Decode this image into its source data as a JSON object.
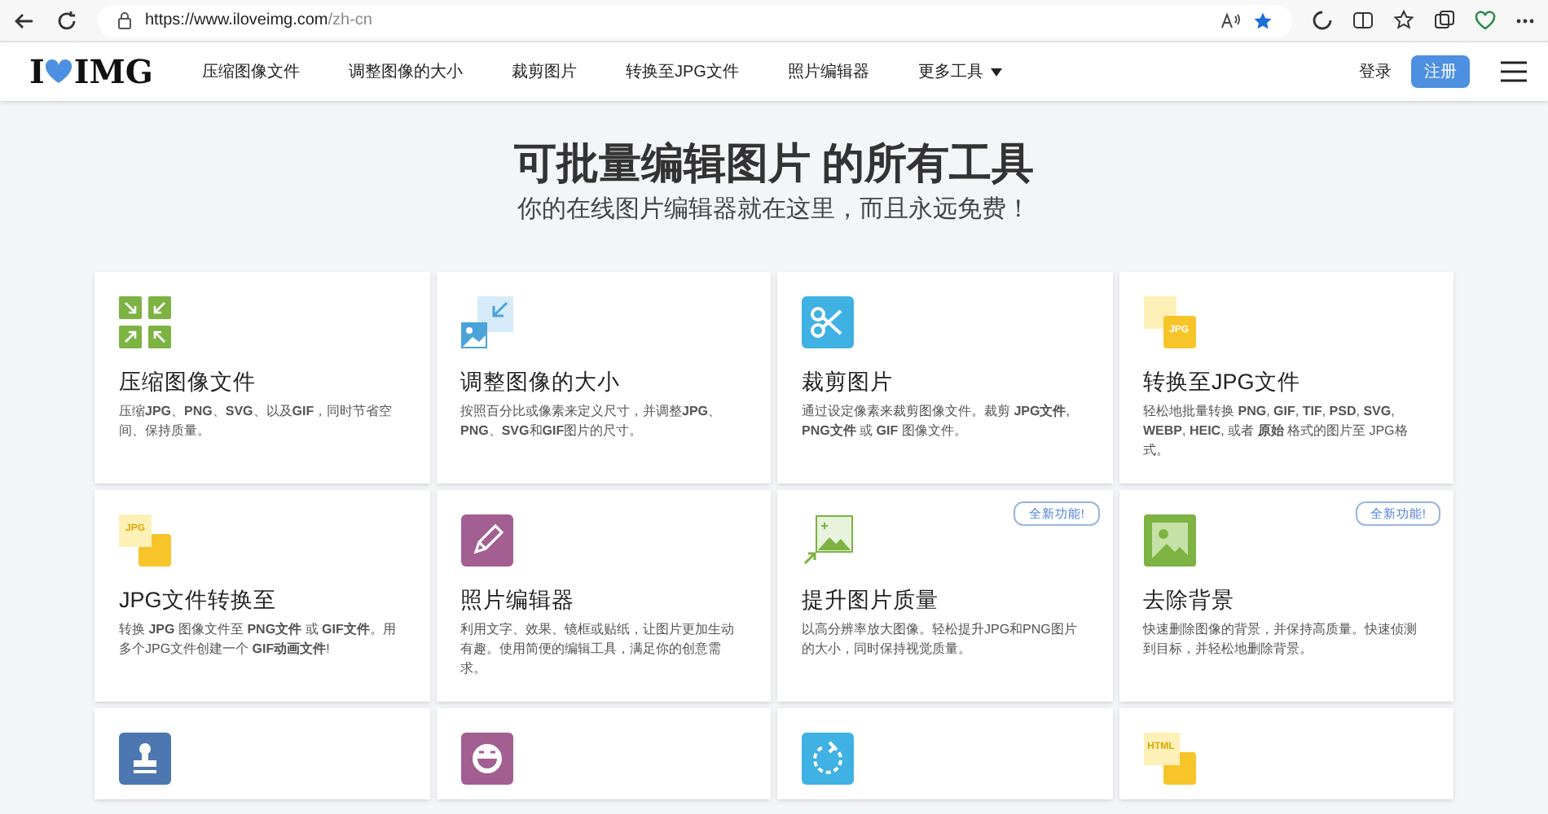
{
  "browser": {
    "url_host": "https://www.iloveimg.com",
    "url_path": "/zh-cn"
  },
  "nav": {
    "logo_left": "I",
    "logo_right": "IMG",
    "links": [
      {
        "label": "压缩图像文件",
        "dropdown": false
      },
      {
        "label": "调整图像的大小",
        "dropdown": false
      },
      {
        "label": "裁剪图片",
        "dropdown": false
      },
      {
        "label": "转换至JPG文件",
        "dropdown": false
      },
      {
        "label": "照片编辑器",
        "dropdown": false
      },
      {
        "label": "更多工具",
        "dropdown": true
      }
    ],
    "login": "登录",
    "signup": "注册"
  },
  "hero": {
    "title": "可批量编辑图片 的所有工具",
    "subtitle": "你的在线图片编辑器就在这里，而且永远免费！"
  },
  "tools": [
    {
      "kind": "full",
      "title": "压缩图像文件",
      "description": "压缩**JPG**、**PNG**、**SVG**、以及**GIF**，同时节省空间、保持质量。"
    },
    {
      "kind": "full",
      "title": "调整图像的大小",
      "description": "按照百分比或像素来定义尺寸，并调整**JPG**、**PNG**、**SVG**和**GIF**图片的尺寸。"
    },
    {
      "kind": "full",
      "title": "裁剪图片",
      "description": "通过设定像素来裁剪图像文件。裁剪 **JPG文件**, **PNG文件** 或 **GIF** 图像文件。"
    },
    {
      "kind": "full",
      "icon_text": "JPG",
      "title": "转换至JPG文件",
      "description": "轻松地批量转换 **PNG**, **GIF**, **TIF**, **PSD**, **SVG**, **WEBP**, **HEIC**, 或者 **原始** 格式的图片至 JPG格式。"
    },
    {
      "kind": "full",
      "icon_text": "JPG",
      "title": "JPG文件转换至",
      "description": "转换 **JPG** 图像文件至 **PNG文件** 或 **GIF文件**。用多个JPG文件创建一个 **GIF动画文件**!"
    },
    {
      "kind": "full",
      "title": "照片编辑器",
      "description": "利用文字、效果、镜框或贴纸，让图片更加生动有趣。使用简便的编辑工具，满足你的创意需求。"
    },
    {
      "kind": "full",
      "badge": "全新功能!",
      "title": "提升图片质量",
      "description": "以高分辨率放大图像。轻松提升JPG和PNG图片的大小，同时保持视觉质量。"
    },
    {
      "kind": "full",
      "badge": "全新功能!",
      "title": "去除背景",
      "description": "快速删除图像的背景，并保持高质量。快速侦测到目标，并轻松地删除背景。"
    },
    {
      "kind": "cut_off"
    },
    {
      "kind": "cut_off"
    },
    {
      "kind": "cut_off"
    },
    {
      "kind": "cut_off",
      "icon_text": "HTML"
    }
  ]
}
